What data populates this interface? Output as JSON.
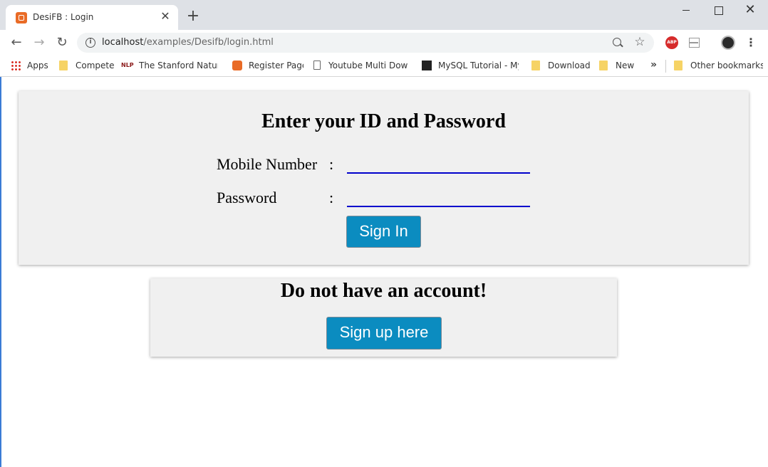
{
  "browser": {
    "tab_title": "DesiFB : Login",
    "tab_close": "✕",
    "new_tab": "+",
    "url_host": "localhost",
    "url_path": "/examples/Desifb/login.html",
    "abp_label": "ABP",
    "win_close": "✕",
    "back": "←",
    "forward": "→",
    "reload": "↻",
    "star": "☆",
    "menu": "⋮",
    "bookmarks_more": "»",
    "bookmarks": [
      {
        "label": "Apps",
        "icon": "apps-icon"
      },
      {
        "label": "Compete",
        "icon": "folder-icon"
      },
      {
        "label": "The Stanford Natural",
        "icon": "nlp-icon"
      },
      {
        "label": "Register Page",
        "icon": "xampp-icon"
      },
      {
        "label": "Youtube Multi Downl",
        "icon": "page-icon"
      },
      {
        "label": "MySQL Tutorial - My",
        "icon": "terminal-icon"
      },
      {
        "label": "Download",
        "icon": "folder-icon"
      },
      {
        "label": "New",
        "icon": "folder-icon"
      },
      {
        "label": "Other bookmarks",
        "icon": "folder-icon"
      }
    ],
    "nlp_icon_text": "NLP"
  },
  "login": {
    "title": "Enter your ID and Password",
    "mobile_label": "Mobile Number",
    "password_label": "Password",
    "colon": ":",
    "mobile_value": "",
    "password_value": "",
    "signin_label": "Sign In"
  },
  "signup": {
    "title": "Do not have an account!",
    "button_label": "Sign up here"
  },
  "colors": {
    "button_bg": "#0b8cc0",
    "input_underline": "#0000cc",
    "card_bg": "#f0f0f0"
  }
}
